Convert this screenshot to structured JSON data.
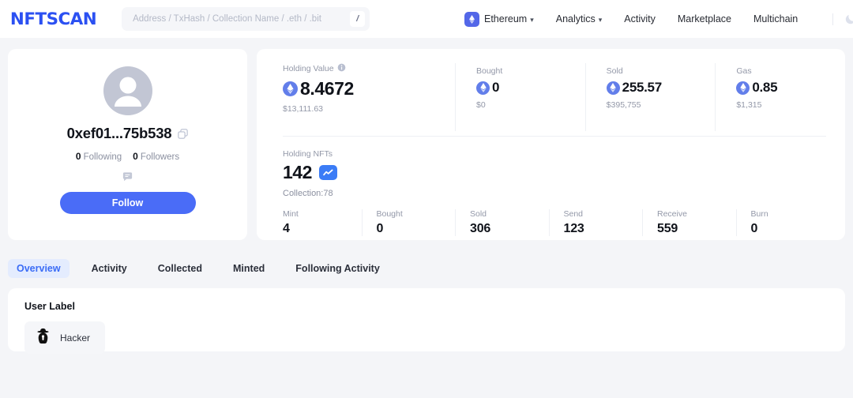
{
  "header": {
    "logo": "NFTSCAN",
    "search": {
      "placeholder": "Address / TxHash / Collection Name / .eth / .bit",
      "value": "",
      "shortcut": "/"
    },
    "chain": {
      "label": "Ethereum",
      "caret": "⌄"
    },
    "nav": [
      {
        "label": "Analytics",
        "caret": "⌄",
        "has_caret": true
      },
      {
        "label": "Activity",
        "has_caret": false
      },
      {
        "label": "Marketplace",
        "has_caret": false
      },
      {
        "label": "Multichain",
        "has_caret": false
      }
    ],
    "theme_toggle": "moon-icon",
    "wallet_icon": "card-icon"
  },
  "profile": {
    "avatar": "user-avatar-placeholder",
    "address": "0xef01...75b538",
    "copy_icon": "copy-icon",
    "following_count": "0",
    "following_label": "Following",
    "followers_count": "0",
    "followers_label": "Followers",
    "chat_icon": "chat-bubble-icon",
    "follow_button": "Follow"
  },
  "stats": {
    "holding_value": {
      "label": "Holding Value",
      "info_icon": "info-icon",
      "value": "8.4672",
      "usd": "$13,111.63",
      "currency_icon": "ethereum-icon"
    },
    "summary": [
      {
        "label": "Bought",
        "value": "0",
        "usd": "$0"
      },
      {
        "label": "Sold",
        "value": "255.57",
        "usd": "$395,755"
      },
      {
        "label": "Gas",
        "value": "0.85",
        "usd": "$1,315"
      }
    ],
    "holding_nfts": {
      "label": "Holding NFTs",
      "value": "142",
      "trend_icon": "trend-chart-icon",
      "collection": "Collection:78"
    },
    "activity": [
      {
        "label": "Mint",
        "value": "4"
      },
      {
        "label": "Bought",
        "value": "0"
      },
      {
        "label": "Sold",
        "value": "306"
      },
      {
        "label": "Send",
        "value": "123"
      },
      {
        "label": "Receive",
        "value": "559"
      },
      {
        "label": "Burn",
        "value": "0"
      }
    ]
  },
  "tabs": [
    {
      "label": "Overview",
      "active": true
    },
    {
      "label": "Activity",
      "active": false
    },
    {
      "label": "Collected",
      "active": false
    },
    {
      "label": "Minted",
      "active": false
    },
    {
      "label": "Following Activity",
      "active": false
    }
  ],
  "user_label": {
    "title": "User Label",
    "badges": [
      {
        "label": "Hacker",
        "icon": "hacker-spy-icon"
      }
    ]
  },
  "colors": {
    "brand_blue": "#2b50f2",
    "accent_blue": "#4a6cf7",
    "active_tab_bg": "#e4ecfe",
    "page_bg": "#f4f5f8",
    "eth_icon": "#627eea"
  }
}
